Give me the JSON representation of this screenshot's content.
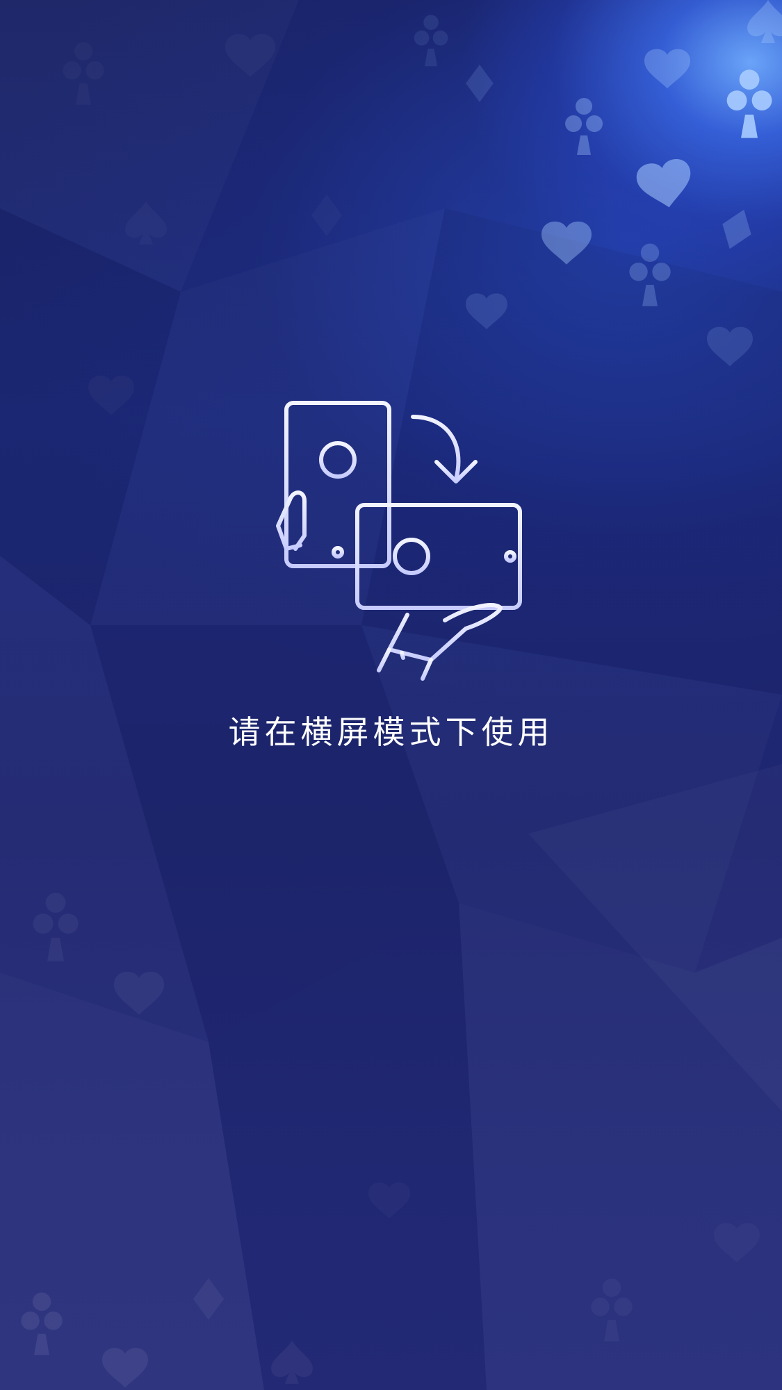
{
  "screen": {
    "message": "请在横屏模式下使用",
    "illustration_icon": "rotate-device-icon",
    "background": "blue-poker-suits-background"
  },
  "colors": {
    "background_dark": "#1d2468",
    "highlight": "#6aa8ff",
    "icon_stroke": "#dfe4ff",
    "text": "#ffffff"
  }
}
